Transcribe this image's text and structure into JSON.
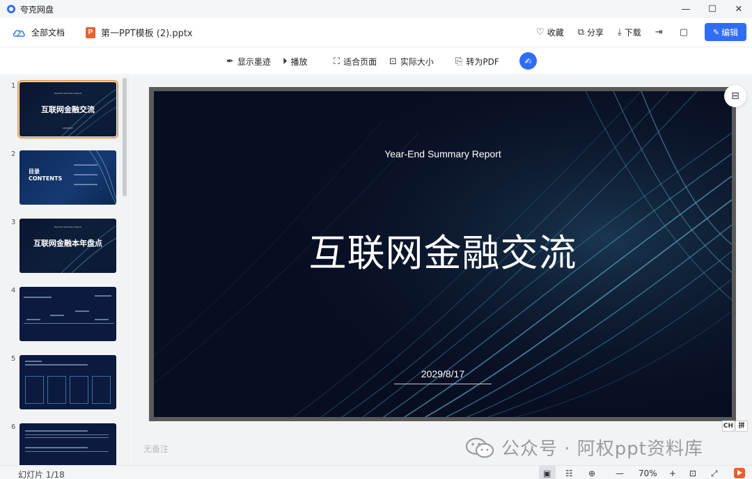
{
  "app": {
    "title": "夸克网盘"
  },
  "window_controls": {
    "minimize": "—",
    "maximize": "☐",
    "close": "✕"
  },
  "header": {
    "all_docs": "全部文档",
    "ppt_badge": "P",
    "filename": "第一PPT模板 (2).pptx",
    "actions": {
      "favorite": "收藏",
      "share": "分享",
      "download": "下载"
    },
    "edit": "编辑"
  },
  "toolbar": {
    "show_ink": "显示墨迹",
    "play": "播放",
    "fit_page": "适合页面",
    "actual_size": "实际大小",
    "to_pdf": "转为PDF"
  },
  "thumbnails": [
    {
      "num": "1",
      "title": "互联网金融交流",
      "selected": true
    },
    {
      "num": "2",
      "title_line1": "目录",
      "title_line2": "CONTENTS"
    },
    {
      "num": "3",
      "title": "互联网金融本年盘点"
    },
    {
      "num": "4"
    },
    {
      "num": "5"
    },
    {
      "num": "6"
    }
  ],
  "slide": {
    "subtitle": "Year-End Summary Report",
    "title": "互联网金融交流",
    "date": "2029/8/17"
  },
  "notes_placeholder": "无备注",
  "ime": {
    "lang": "CH",
    "mode": "拼"
  },
  "watermark": "公众号 · 阿权ppt资料库",
  "status": {
    "slide_count": "幻灯片 1/18",
    "zoom": "70%",
    "zoom_out": "—",
    "zoom_in": "+"
  }
}
